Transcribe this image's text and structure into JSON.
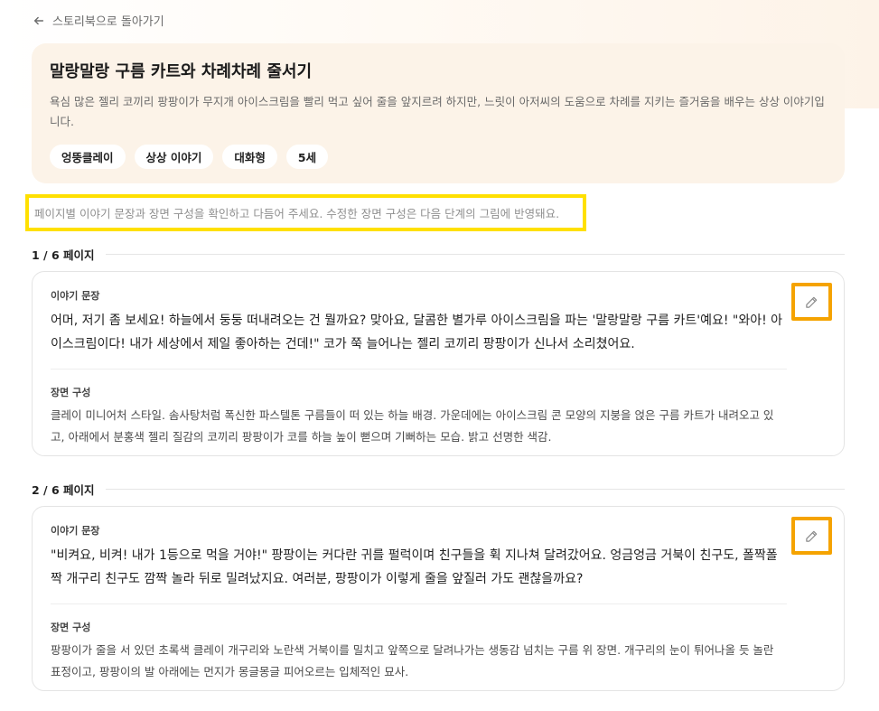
{
  "nav": {
    "back_label": "스토리북으로 돌아가기"
  },
  "story": {
    "title": "말랑말랑 구름 카트와 차례차례 줄서기",
    "description": "욕심 많은 젤리 코끼리 팡팡이가 무지개 아이스크림을 빨리 먹고 싶어 줄을 앞지르려 하지만, 느릿이 아저씨의 도움으로 차례를 지키는 즐거움을 배우는 상상 이야기입니다.",
    "tags": [
      "엉뚱클레이",
      "상상 이야기",
      "대화형",
      "5세"
    ]
  },
  "hint": "페이지별 이야기 문장과 장면 구성을 확인하고 다듬어 주세요. 수정한 장면 구성은 다음 단계의 그림에 반영돼요.",
  "labels": {
    "story_text": "이야기 문장",
    "scene": "장면 구성"
  },
  "pages": [
    {
      "header": "1 / 6 페이지",
      "text": "어머, 저기 좀 보세요! 하늘에서 둥둥 떠내려오는 건 뭘까요? 맞아요, 달콤한 별가루 아이스크림을 파는 '말랑말랑 구름 카트'예요! \"와아! 아이스크림이다! 내가 세상에서 제일 좋아하는 건데!\" 코가 쭉 늘어나는 젤리 코끼리 팡팡이가 신나서 소리쳤어요.",
      "scene": "클레이 미니어처 스타일. 솜사탕처럼 폭신한 파스텔톤 구름들이 떠 있는 하늘 배경. 가운데에는 아이스크림 콘 모양의 지붕을 얹은 구름 카트가 내려오고 있고, 아래에서 분홍색 젤리 질감의 코끼리 팡팡이가 코를 하늘 높이 뻗으며 기뻐하는 모습. 밝고 선명한 색감."
    },
    {
      "header": "2 / 6 페이지",
      "text": "\"비켜요, 비켜! 내가 1등으로 먹을 거야!\" 팡팡이는 커다란 귀를 펄럭이며 친구들을 휙 지나쳐 달려갔어요. 엉금엉금 거북이 친구도, 폴짝폴짝 개구리 친구도 깜짝 놀라 뒤로 밀려났지요. 여러분, 팡팡이가 이렇게 줄을 앞질러 가도 괜찮을까요?",
      "scene": "팡팡이가 줄을 서 있던 초록색 클레이 개구리와 노란색 거북이를 밀치고 앞쪽으로 달려나가는 생동감 넘치는 구름 위 장면. 개구리의 눈이 튀어나올 듯 놀란 표정이고, 팡팡이의 발 아래에는 먼지가 몽글몽글 피어오르는 입체적인 묘사."
    }
  ]
}
